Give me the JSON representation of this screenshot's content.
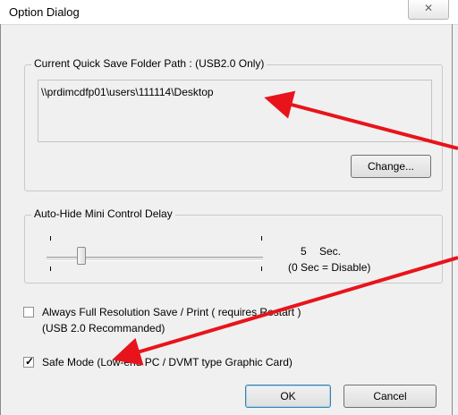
{
  "window": {
    "title": "Option Dialog",
    "close_glyph": "✕"
  },
  "save_path_group": {
    "label": "Current Quick Save Folder Path : (USB2.0 Only)",
    "path_value": "\\\\prdimcdfp01\\users\\111114\\Desktop",
    "change_button": "Change..."
  },
  "auto_hide_group": {
    "label": "Auto-Hide Mini Control Delay",
    "slider_value_fraction": 0.16,
    "delay_value": "5",
    "delay_unit": "Sec.",
    "disable_note": "(0 Sec = Disable)"
  },
  "options": {
    "full_res_label": "Always Full Resolution Save / Print  ( requires Restart )",
    "full_res_sub_label": "(USB 2.0 Recommanded)",
    "full_res_checked": false,
    "safe_mode_label": "Safe Mode (Low-end PC / DVMT type Graphic Card)",
    "safe_mode_checked": true
  },
  "buttons": {
    "ok": "OK",
    "cancel": "Cancel"
  },
  "annotation": {
    "arrow_color": "#e8141b"
  }
}
